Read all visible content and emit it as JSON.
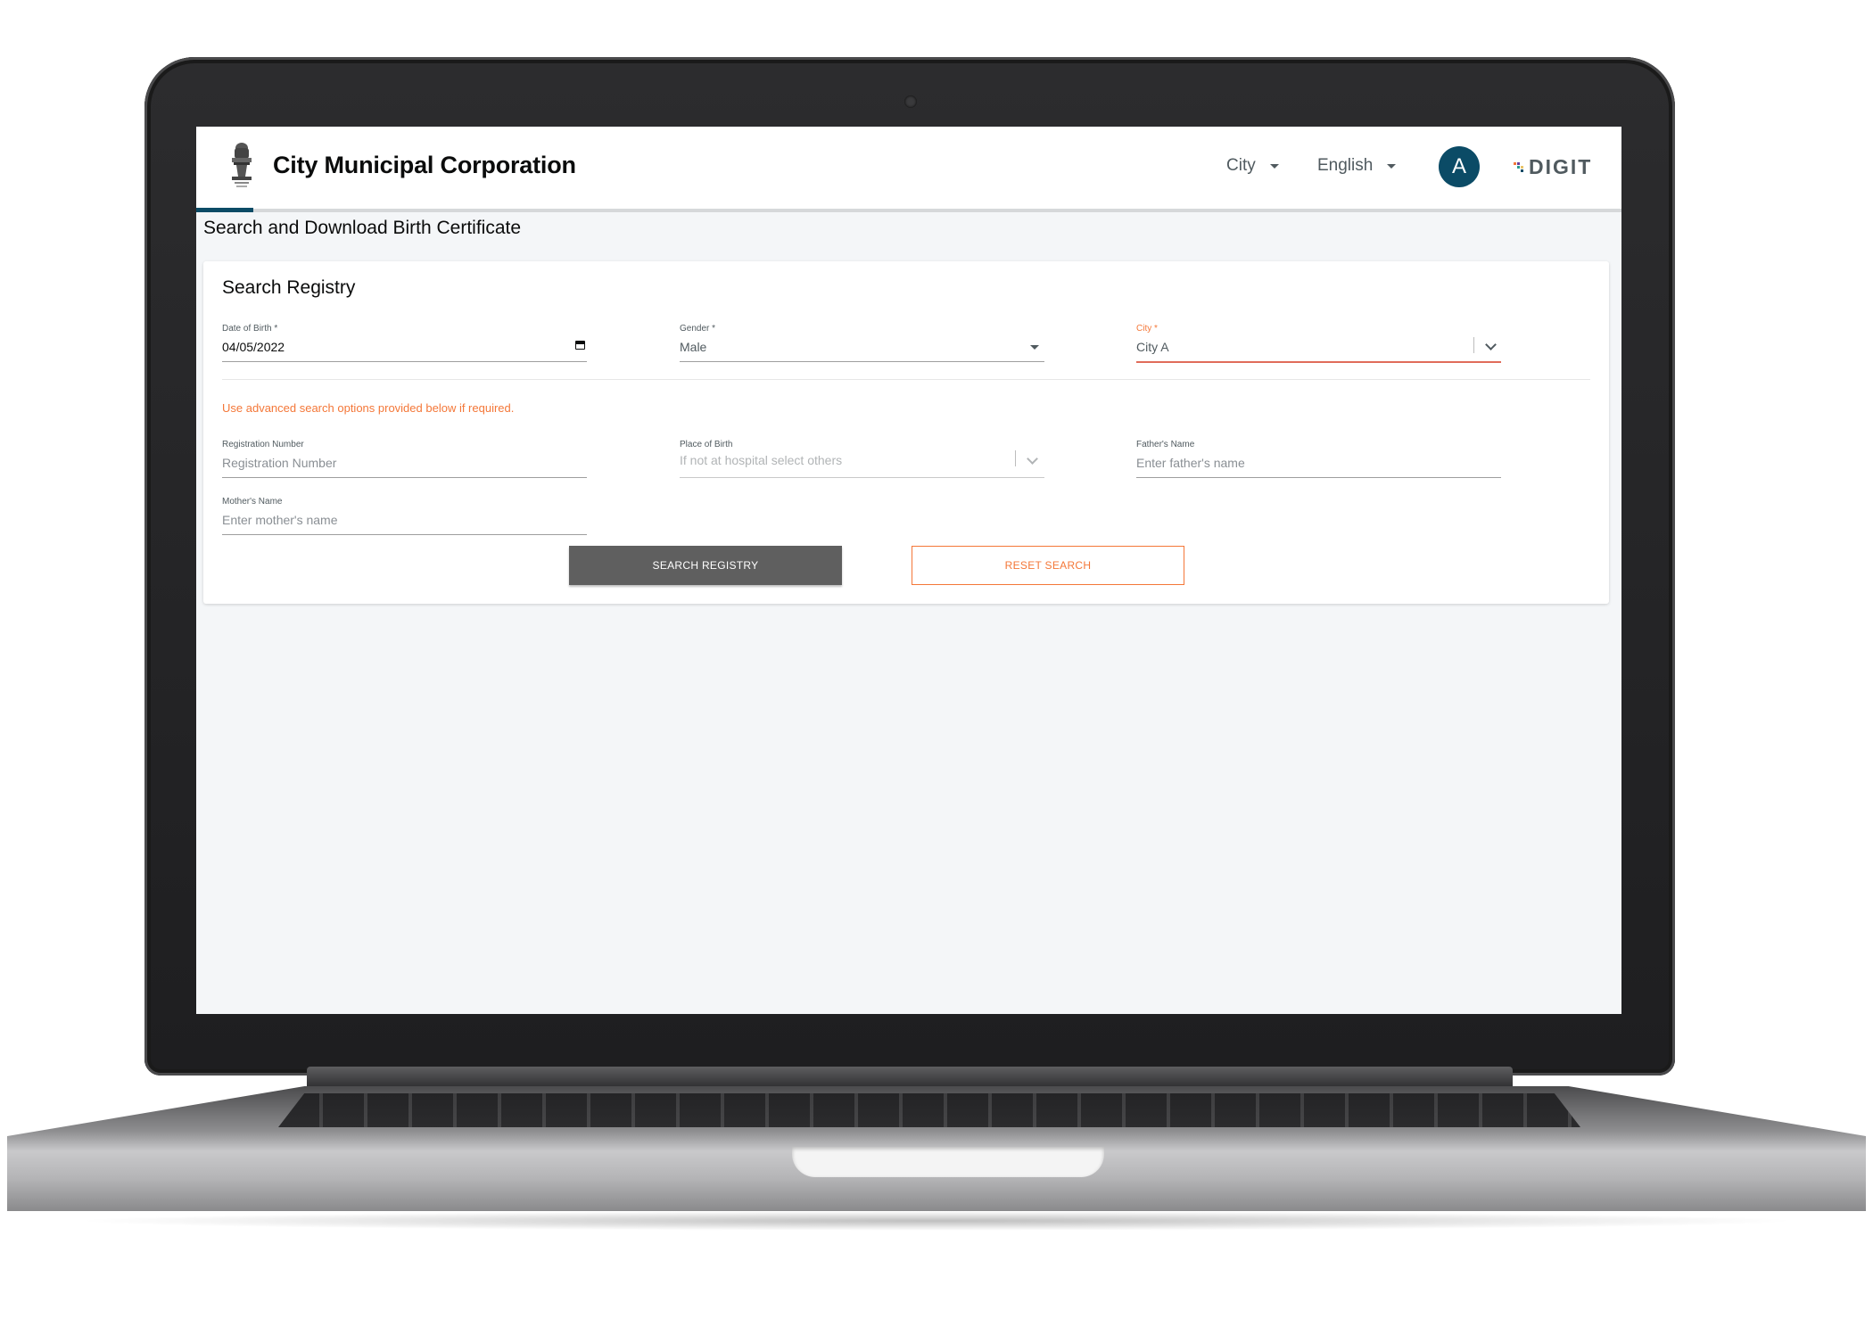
{
  "header": {
    "org_name": "City Municipal Corporation",
    "city_dropdown": "City",
    "language_dropdown": "English",
    "avatar_initial": "A",
    "brand_logo_text": "DIGIT"
  },
  "page": {
    "title": "Search and Download Birth Certificate"
  },
  "search_form": {
    "title": "Search Registry",
    "date_of_birth": {
      "label": "Date of Birth *",
      "value": "04/05/2022"
    },
    "gender": {
      "label": "Gender *",
      "value": "Male"
    },
    "city": {
      "label": "City *",
      "value": "City A"
    },
    "advanced_hint": "Use advanced search options provided below if required.",
    "registration_number": {
      "label": "Registration Number",
      "placeholder": "Registration Number"
    },
    "place_of_birth": {
      "label": "Place of Birth",
      "placeholder": "If not at hospital select others"
    },
    "fathers_name": {
      "label": "Father's Name",
      "placeholder": "Enter father's name"
    },
    "mothers_name": {
      "label": "Mother's Name",
      "placeholder": "Enter mother's name"
    },
    "search_button": "SEARCH REGISTRY",
    "reset_button": "RESET SEARCH"
  },
  "icons": {
    "emblem": "national-emblem-icon",
    "calendar": "calendar-icon",
    "dropdown": "caret-down-icon",
    "chevron": "chevron-down-icon"
  },
  "colors": {
    "accent": "#0b4b66",
    "warning": "#f47738",
    "error": "#e06c5a",
    "primary_button": "#5f5f5f"
  }
}
